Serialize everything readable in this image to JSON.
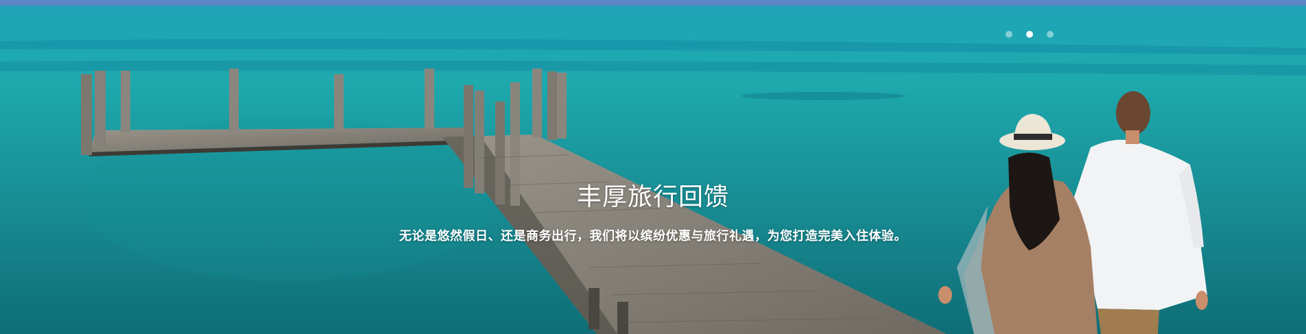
{
  "hero": {
    "title": "丰厚旅行回馈",
    "subtitle": "无论是悠然假日、还是商务出行，我们将以缤纷优惠与旅行礼遇，为您打造完美入住体验。",
    "image_subject": "beach-pier-couple",
    "colors": {
      "sea_light": "#2bb7b6",
      "sea_deep": "#0b6d8d",
      "pier": "#6b6a63"
    }
  },
  "carousel": {
    "slide_count": 3,
    "active_index": 1
  }
}
